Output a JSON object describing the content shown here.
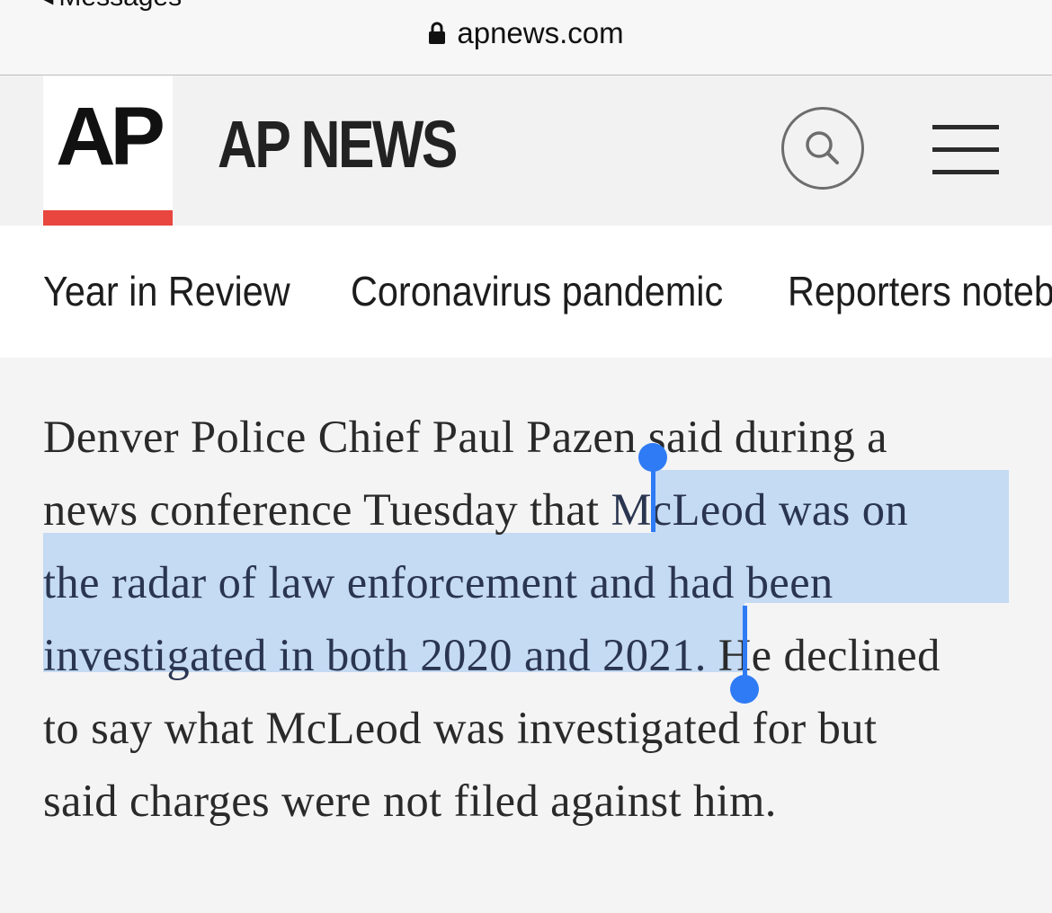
{
  "status": {
    "back_label": "Messages",
    "back_icon": "chevron-left-icon"
  },
  "browser": {
    "url": "apnews.com",
    "lock_icon": "lock-icon"
  },
  "header": {
    "logo_text": "AP",
    "title": "AP NEWS",
    "logo_accent_color": "#e8463f",
    "search_icon": "search-icon",
    "menu_icon": "hamburger-menu-icon"
  },
  "nav": {
    "items": [
      "Year in Review",
      "Coronavirus pandemic",
      "Reporters notebook"
    ]
  },
  "article": {
    "text_before_selection": "Denver Police Chief Paul Pazen said during a news conference Tuesday that ",
    "selected_text": "McLeod was on the radar of law enforcement and had been investigated in both 2020 and 2021.",
    "text_after_selection": " He declined to say what McLeod was investigated for but said charges were not filed against him.",
    "selection_color": "#c5daf3",
    "handle_color": "#2f7bf5",
    "lines": [
      {
        "plain_before": "Denver Police Chief Paul Pazen said during a",
        "selected": "",
        "plain_after": ""
      },
      {
        "plain_before": "news conference Tuesday that ",
        "selected": "McLeod was on",
        "plain_after": ""
      },
      {
        "plain_before": "",
        "selected": "the radar of law enforcement and had been",
        "plain_after": ""
      },
      {
        "plain_before": "",
        "selected": "investigated in both 2020 and 2021.",
        "plain_after": " He declined"
      },
      {
        "plain_before": "to say what McLeod was investigated for but",
        "selected": "",
        "plain_after": ""
      },
      {
        "plain_before": "said charges were not filed against him.",
        "selected": "",
        "plain_after": ""
      }
    ]
  }
}
